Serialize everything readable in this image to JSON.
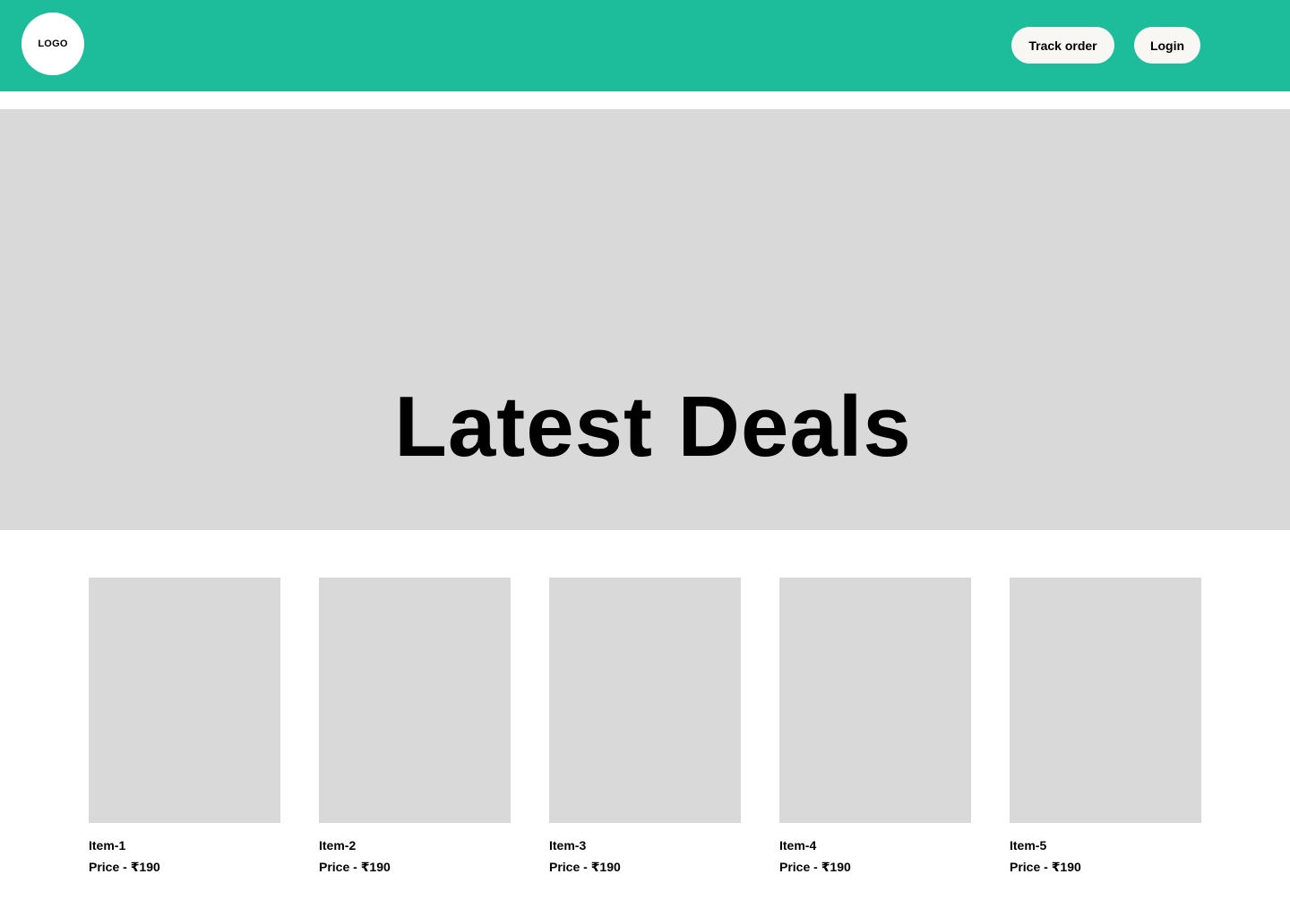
{
  "header": {
    "logo_text": "LOGO",
    "track_order_label": "Track order",
    "login_label": "Login"
  },
  "hero": {
    "title": "Latest Deals"
  },
  "products": [
    {
      "name": "Item-1",
      "price": "Price - ₹190"
    },
    {
      "name": "Item-2",
      "price": "Price - ₹190"
    },
    {
      "name": "Item-3",
      "price": "Price - ₹190"
    },
    {
      "name": "Item-4",
      "price": "Price - ₹190"
    },
    {
      "name": "Item-5",
      "price": "Price - ₹190"
    }
  ],
  "colors": {
    "header_bg": "#1dbd9b",
    "placeholder_gray": "#d9d9d9",
    "button_bg": "#f8f7f4"
  }
}
